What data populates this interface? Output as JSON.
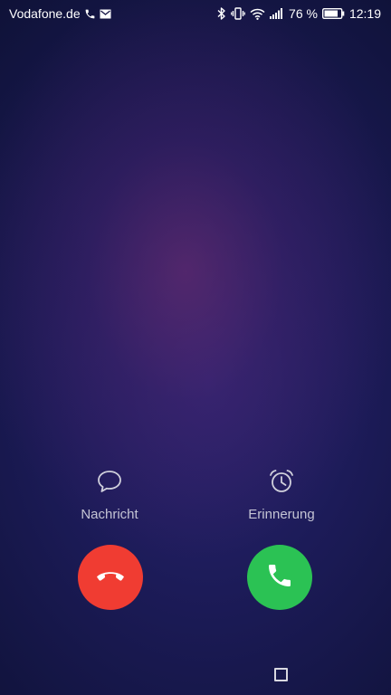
{
  "status_bar": {
    "carrier": "Vodafone.de",
    "battery_percent": "76 %",
    "time": "12:19",
    "icons": [
      "phone-icon",
      "mail-icon",
      "bluetooth-icon",
      "vibrate-icon",
      "wifi-icon",
      "signal-icon",
      "battery-icon"
    ]
  },
  "actions": {
    "message_label": "Nachricht",
    "reminder_label": "Erinnerung"
  },
  "call_buttons": {
    "decline_color": "#f03c32",
    "accept_color": "#2bc254"
  }
}
